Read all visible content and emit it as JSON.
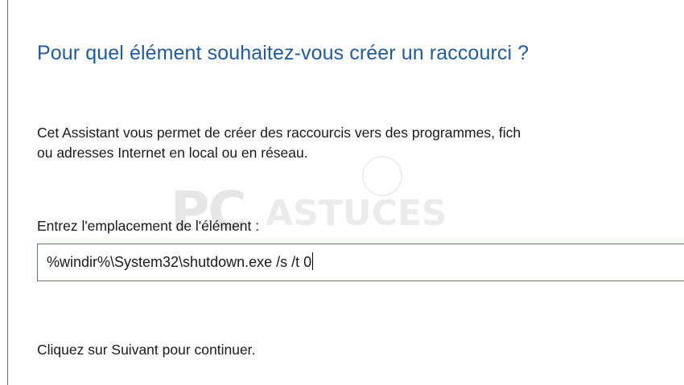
{
  "dialog": {
    "heading": "Pour quel élément souhaitez-vous créer un raccourci ?",
    "description_line1": "Cet Assistant vous permet de créer des raccourcis vers des programmes, fich",
    "description_line2": "ou adresses Internet en local ou en réseau.",
    "location_label": "Entrez l'emplacement de l'élément :",
    "location_value": "%windir%\\System32\\shutdown.exe /s /t 0",
    "footer_text": "Cliquez sur Suivant pour continuer."
  },
  "watermark": {
    "brand_part1": "PC",
    "brand_part2": "ASTUCES"
  },
  "colors": {
    "heading": "#1e5ba8",
    "input_border": "#3c7fd1"
  }
}
